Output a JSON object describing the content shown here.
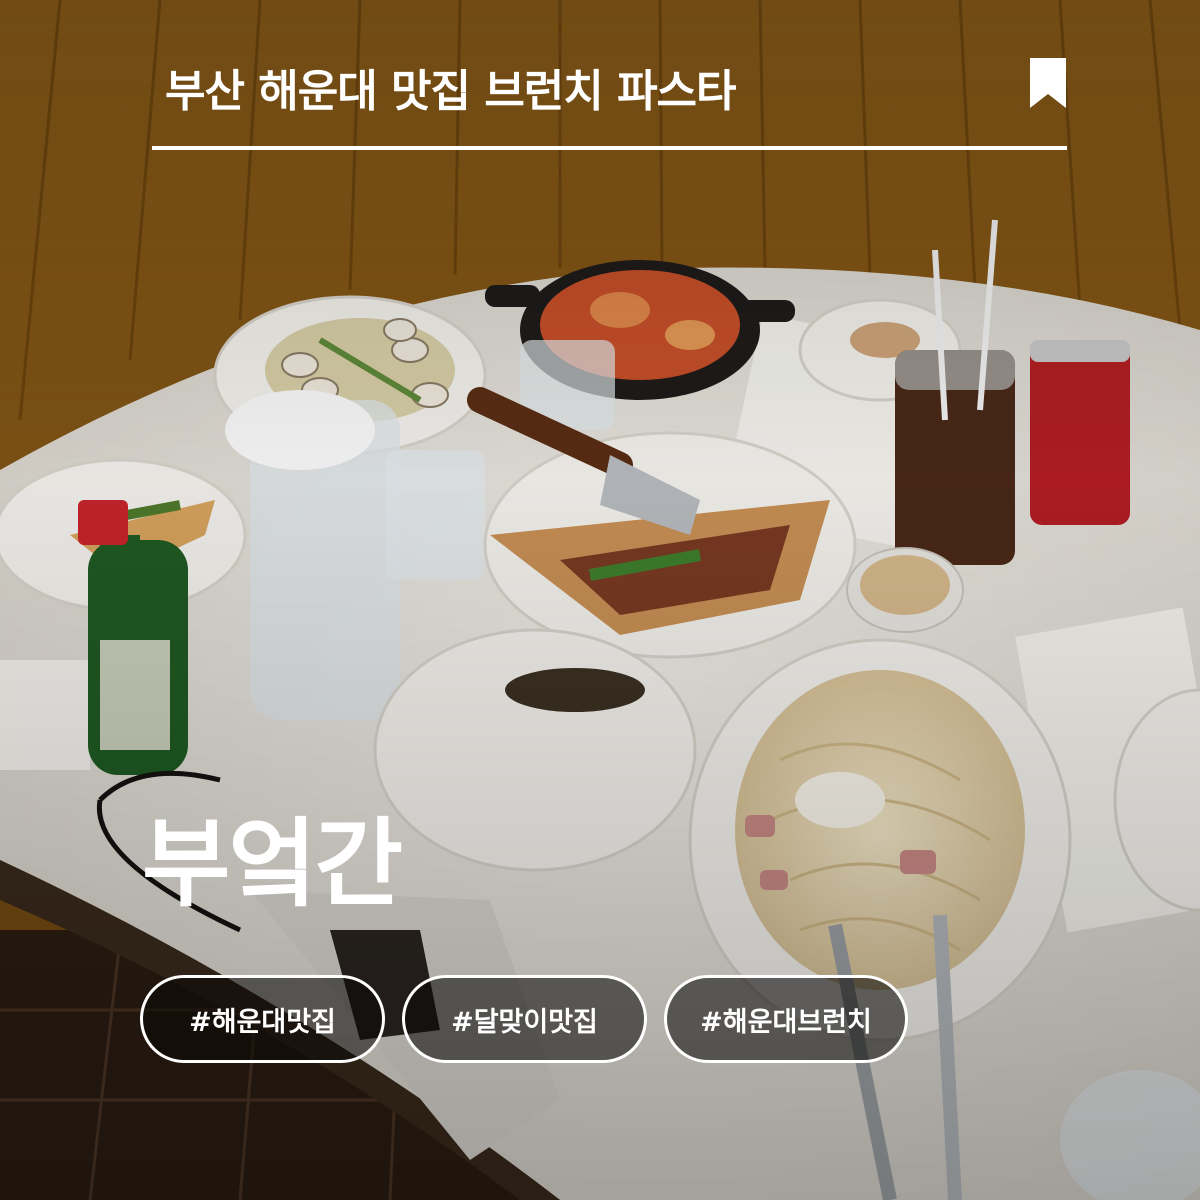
{
  "header": {
    "title": "부산 해운대 맛집 브런치 파스타",
    "bookmark_icon": "bookmark-icon"
  },
  "store": {
    "name": "부엌간"
  },
  "hashtags": [
    "#해운대맛집",
    "#달맞이맛집",
    "#해운대브런치"
  ],
  "colors": {
    "text": "#ffffff",
    "booth": "#b8862c",
    "table": "#e9e6df",
    "tag_bg": "rgba(10,8,6,0.55)"
  }
}
